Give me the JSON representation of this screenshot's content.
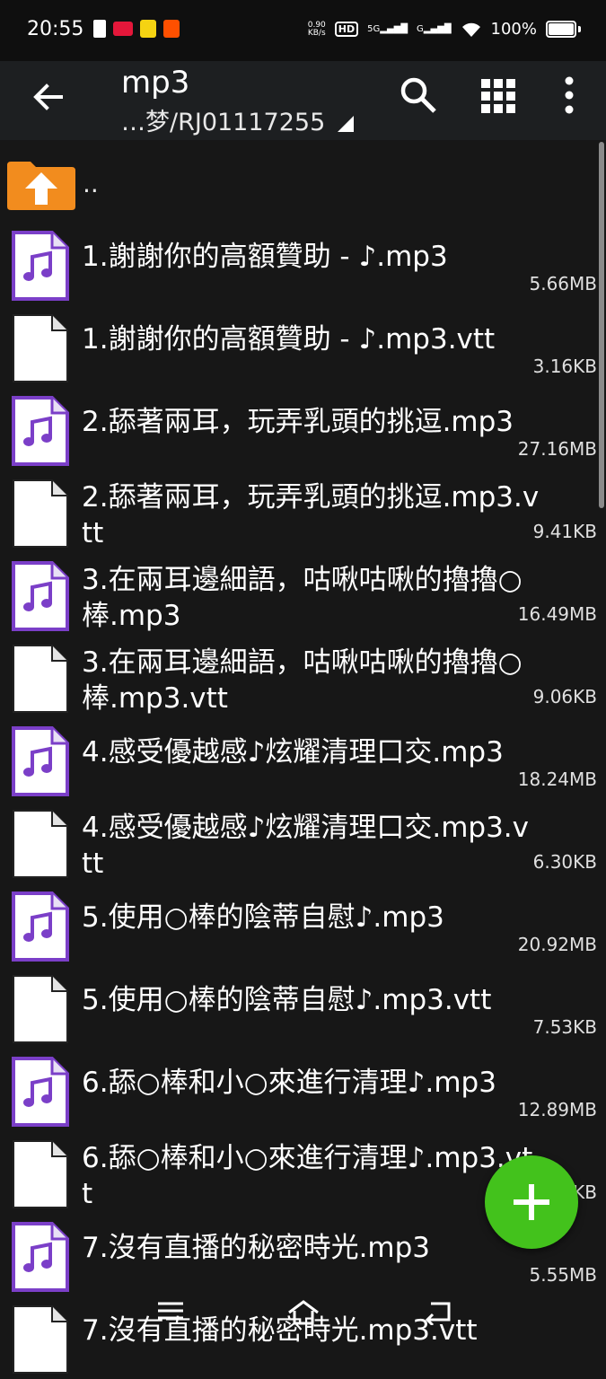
{
  "status_bar": {
    "time": "20:55",
    "net_speed": "0.90\nKB/s",
    "hd": "HD",
    "sig1": "5G",
    "sig2": "G",
    "battery": "100%"
  },
  "toolbar": {
    "title": "mp3",
    "path": "…梦/RJ01117255"
  },
  "up_label": "..",
  "files": [
    {
      "name": "1.謝謝你的高額贊助 - ♪.mp3",
      "size": "5.66MB",
      "type": "audio"
    },
    {
      "name": "1.謝謝你的高額贊助 - ♪.mp3.vtt",
      "size": "3.16KB",
      "type": "doc"
    },
    {
      "name": "2.舔著兩耳，玩弄乳頭的挑逗.mp3",
      "size": "27.16MB",
      "type": "audio"
    },
    {
      "name": "2.舔著兩耳，玩弄乳頭的挑逗.mp3.vtt",
      "size": "9.41KB",
      "type": "doc"
    },
    {
      "name": "3.在兩耳邊細語，咕啾咕啾的擼擼○棒.mp3",
      "size": "16.49MB",
      "type": "audio"
    },
    {
      "name": "3.在兩耳邊細語，咕啾咕啾的擼擼○棒.mp3.vtt",
      "size": "9.06KB",
      "type": "doc"
    },
    {
      "name": "4.感受優越感♪炫耀清理口交.mp3",
      "size": "18.24MB",
      "type": "audio"
    },
    {
      "name": "4.感受優越感♪炫耀清理口交.mp3.vtt",
      "size": "6.30KB",
      "type": "doc"
    },
    {
      "name": "5.使用○棒的陰蒂自慰♪.mp3",
      "size": "20.92MB",
      "type": "audio"
    },
    {
      "name": "5.使用○棒的陰蒂自慰♪.mp3.vtt",
      "size": "7.53KB",
      "type": "doc"
    },
    {
      "name": "6.舔○棒和小○來進行清理♪.mp3",
      "size": "12.89MB",
      "type": "audio"
    },
    {
      "name": "6.舔○棒和小○來進行清理♪.mp3.vtt",
      "size": "KB",
      "type": "doc"
    },
    {
      "name": "7.沒有直播的秘密時光.mp3",
      "size": "5.55MB",
      "type": "audio"
    },
    {
      "name": "7.沒有直播的秘密時光.mp3.vtt",
      "size": "",
      "type": "doc"
    }
  ],
  "icons": {
    "back": "arrow-left-icon",
    "search": "search-icon",
    "grid": "grid-view-icon",
    "more": "more-vert-icon",
    "fab": "plus-icon"
  },
  "colors": {
    "audio_accent": "#7b3fc8",
    "fab": "#43c21c",
    "up_folder": "#f28c1e"
  }
}
